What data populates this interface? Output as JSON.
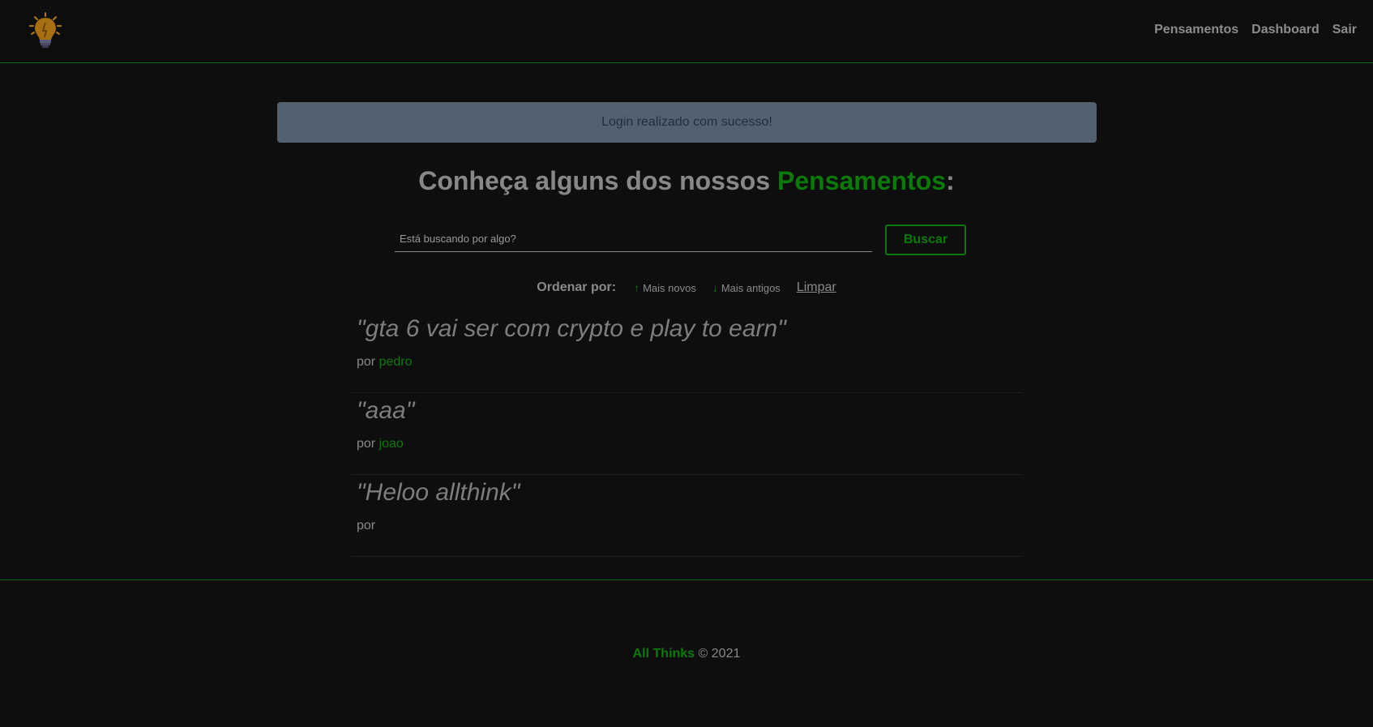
{
  "nav": {
    "logo_icon": "lightbulb-icon",
    "links": [
      "Pensamentos",
      "Dashboard",
      "Sair"
    ]
  },
  "flash": {
    "message": "Login realizado com sucesso!"
  },
  "title": {
    "prefix": "Conheça alguns dos nossos ",
    "accent": "Pensamentos",
    "suffix": ":"
  },
  "search": {
    "placeholder": "Está buscando por algo?",
    "value": "",
    "button_label": "Buscar"
  },
  "order": {
    "label": "Ordenar por:",
    "newest": "Mais novos",
    "oldest": "Mais antigos",
    "clear": "Limpar",
    "newest_icon": "arrow-up-icon",
    "oldest_icon": "arrow-down-icon"
  },
  "thoughts": [
    {
      "text": "\"gta 6 vai ser com crypto e play to earn\"",
      "by": "por",
      "author": "pedro"
    },
    {
      "text": "\"aaa\"",
      "by": "por",
      "author": "joao"
    },
    {
      "text": "\"Heloo allthink\"",
      "by": "por",
      "author": ""
    }
  ],
  "footer": {
    "brand": "All Thinks",
    "copyright": "© 2021"
  },
  "colors": {
    "background": "#0e0e0e",
    "accent": "#0b7a0b",
    "flash_bg": "#536070",
    "flash_text": "#1e2e44",
    "text": "#8a8a8a"
  }
}
